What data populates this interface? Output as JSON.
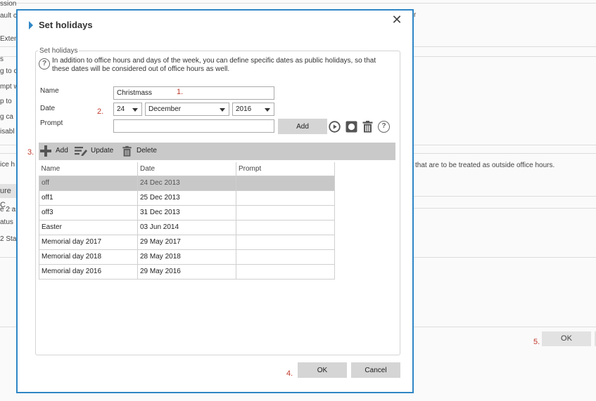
{
  "background": {
    "left_fragments": [
      "ssion",
      "ault c",
      "Exten",
      "s",
      "g to c",
      "mpt w",
      "p to",
      "g ca",
      "isabl",
      "ice h",
      "ure C",
      "e 2 a",
      "atus",
      "2 Sta"
    ],
    "r_fragment": "r",
    "note_fragment": "that are to be treated as outside office hours.",
    "ok_label": "OK",
    "step5": "5."
  },
  "dialog": {
    "title": "Set holidays",
    "close_icon": "close-x-icon",
    "fieldset_legend": "Set holidays",
    "description": "In addition to office hours and days of the week, you can define specific dates as public holidays, so that these dates will be considered out of office hours as well.",
    "form": {
      "name_label": "Name",
      "name_value": "Christmass",
      "date_label": "Date",
      "day_value": "24",
      "month_value": "December",
      "year_value": "2016",
      "prompt_label": "Prompt",
      "prompt_value": "",
      "add_button": "Add",
      "icons": [
        "play-icon",
        "record-icon",
        "trash-icon",
        "help-icon"
      ]
    },
    "steps": {
      "s1": "1.",
      "s2": "2.",
      "s3": "3.",
      "s4": "4."
    },
    "toolbar": {
      "add": "Add",
      "update": "Update",
      "delete": "Delete"
    },
    "table": {
      "headers": [
        "Name",
        "Date",
        "Prompt"
      ],
      "rows": [
        {
          "name": "off",
          "date": "24 Dec 2013",
          "prompt": ""
        },
        {
          "name": "off1",
          "date": "25 Dec 2013",
          "prompt": ""
        },
        {
          "name": "off3",
          "date": "31 Dec 2013",
          "prompt": ""
        },
        {
          "name": "Easter",
          "date": "03 Jun 2014",
          "prompt": ""
        },
        {
          "name": "Memorial day 2017",
          "date": "29 May 2017",
          "prompt": ""
        },
        {
          "name": "Memorial day 2018",
          "date": "28 May 2018",
          "prompt": ""
        },
        {
          "name": "Memorial day 2016",
          "date": "29 May 2016",
          "prompt": ""
        }
      ],
      "selected_row": 0
    },
    "ok_button": "OK",
    "cancel_button": "Cancel"
  },
  "colors": {
    "accent": "#2f86c6",
    "step_marker": "#c0392b",
    "toolbar": "#c9c9c9",
    "selected_row": "#c8c8c8"
  }
}
